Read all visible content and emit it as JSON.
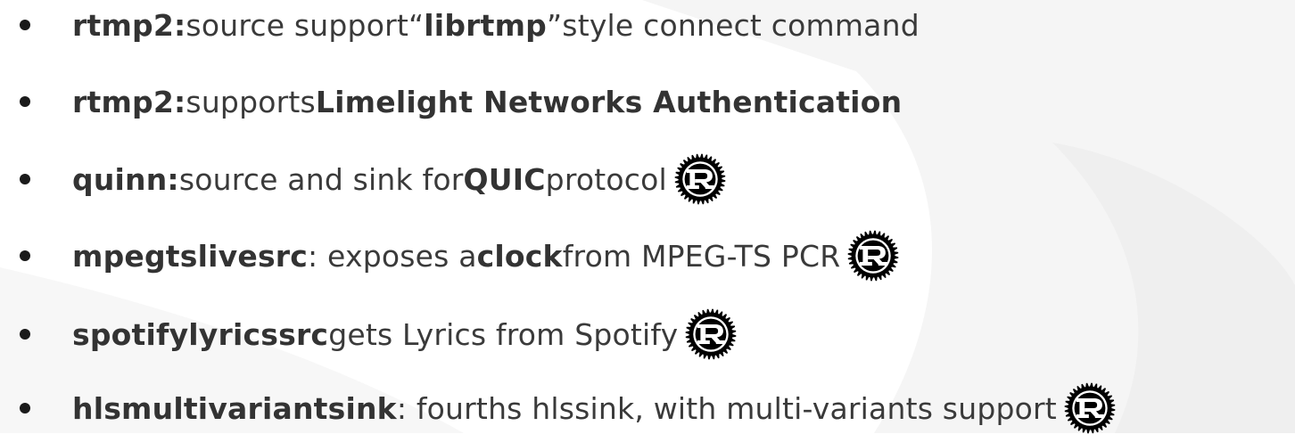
{
  "items": [
    {
      "label": "rtmp2:",
      "text": [
        {
          "t": " source support ",
          "b": false
        },
        {
          "t": "“",
          "b": false
        },
        {
          "t": "librtmp",
          "b": true
        },
        {
          "t": "”",
          "b": false
        },
        {
          "t": " style connect command",
          "b": false
        }
      ],
      "icon": null
    },
    {
      "label": "rtmp2:",
      "text": [
        {
          "t": " supports ",
          "b": false
        },
        {
          "t": "Limelight Networks Authentication",
          "b": true
        }
      ],
      "icon": null
    },
    {
      "label": "quinn:",
      "text": [
        {
          "t": " source and sink for ",
          "b": false
        },
        {
          "t": "QUIC",
          "b": true
        },
        {
          "t": " protocol",
          "b": false
        }
      ],
      "icon": "rust-logo-icon"
    },
    {
      "label": "mpegtslivesrc",
      "text": [
        {
          "t": ": exposes a ",
          "b": false
        },
        {
          "t": "clock",
          "b": true
        },
        {
          "t": " from MPEG-TS PCR",
          "b": false
        }
      ],
      "icon": "rust-logo-icon"
    },
    {
      "label": "spotifylyricssrc",
      "text": [
        {
          "t": " gets Lyrics from Spotify",
          "b": false
        }
      ],
      "icon": "rust-logo-icon"
    },
    {
      "label": "hlsmultivariantsink",
      "text": [
        {
          "t": ": fourths hlssink, with multi-variants support",
          "b": false
        }
      ],
      "icon": "rust-logo-icon"
    }
  ],
  "colors": {
    "text": "#3a3a3a",
    "bold_text": "#333333",
    "bullet": "#1a1a1a",
    "background": "#ffffff",
    "background_shape": "#f4f4f4",
    "icon": "#000000"
  }
}
